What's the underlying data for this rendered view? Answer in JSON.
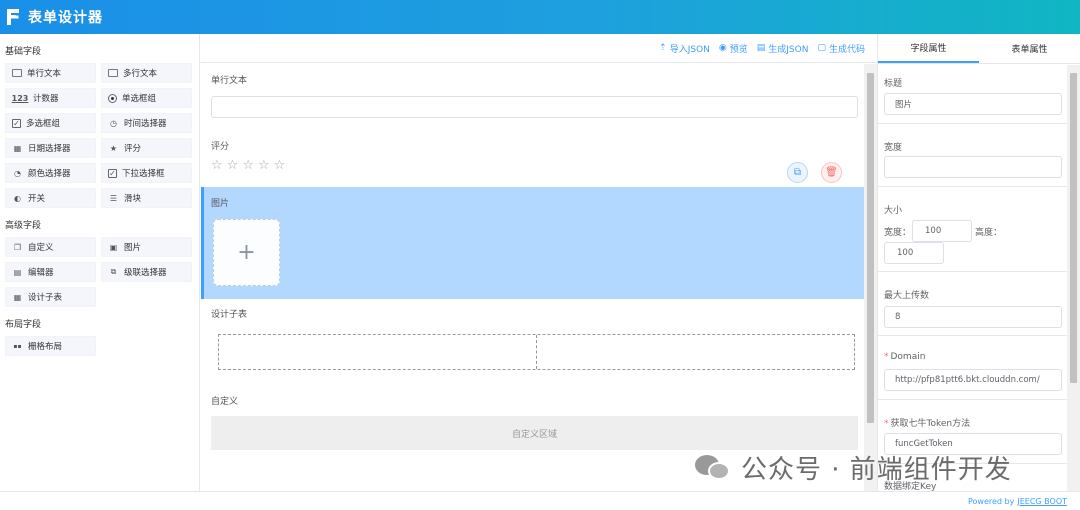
{
  "header": {
    "title": "表单设计器"
  },
  "left": {
    "groups": [
      {
        "title": "基础字段",
        "items": [
          {
            "label": "单行文本",
            "icon": "input-icon"
          },
          {
            "label": "多行文本",
            "icon": "textarea-icon"
          },
          {
            "label": "计数器",
            "icon": "number-icon",
            "glyph": "123"
          },
          {
            "label": "单选框组",
            "icon": "radio-icon"
          },
          {
            "label": "多选框组",
            "icon": "checkbox-icon",
            "glyph": "✓"
          },
          {
            "label": "时间选择器",
            "icon": "clock-icon",
            "glyph": "◷"
          },
          {
            "label": "日期选择器",
            "icon": "calendar-icon",
            "glyph": "▦"
          },
          {
            "label": "评分",
            "icon": "star-icon",
            "glyph": "★"
          },
          {
            "label": "颜色选择器",
            "icon": "palette-icon",
            "glyph": "◔"
          },
          {
            "label": "下拉选择框",
            "icon": "select-icon",
            "glyph": "✓"
          },
          {
            "label": "开关",
            "icon": "switch-icon",
            "glyph": "◐"
          },
          {
            "label": "滑块",
            "icon": "slider-icon",
            "glyph": "☰"
          }
        ]
      },
      {
        "title": "高级字段",
        "items": [
          {
            "label": "自定义",
            "icon": "custom-icon",
            "glyph": "❐"
          },
          {
            "label": "图片",
            "icon": "image-icon",
            "glyph": "▣"
          },
          {
            "label": "编辑器",
            "icon": "editor-icon",
            "glyph": "▤"
          },
          {
            "label": "级联选择器",
            "icon": "cascader-icon",
            "glyph": "⧉"
          },
          {
            "label": "设计子表",
            "icon": "subtable-icon",
            "glyph": "▦"
          }
        ]
      },
      {
        "title": "布局字段",
        "items": [
          {
            "label": "栅格布局",
            "icon": "grid-icon",
            "glyph": "▪▪"
          }
        ]
      }
    ]
  },
  "toolbar": {
    "import_json": "导入JSON",
    "preview": "预览",
    "generate_json": "生成JSON",
    "generate_code": "生成代码"
  },
  "canvas": {
    "single_text_label": "单行文本",
    "rate_label": "评分",
    "stars": [
      "☆",
      "☆",
      "☆",
      "☆",
      "☆"
    ],
    "image_label": "图片",
    "upload_plus": "+",
    "subtable_label": "设计子表",
    "custom_label": "自定义",
    "custom_area_text": "自定义区域"
  },
  "right": {
    "tab_field": "字段属性",
    "tab_form": "表单属性",
    "title_label": "标题",
    "title_value": "图片",
    "width_label": "宽度",
    "width_value": "",
    "size_label": "大小",
    "size_width_label": "宽度：",
    "size_width_value": "100",
    "size_height_label": "高度：",
    "size_height_value": "100",
    "max_upload_label": "最大上传数",
    "max_upload_value": "8",
    "required_mark": "*",
    "domain_label": "Domain",
    "domain_value": "http://pfp81ptt6.bkt.clouddn.com/",
    "token_label": "获取七牛Token方法",
    "token_value": "funcGetToken",
    "bind_key_label": "数据绑定Key"
  },
  "footer": {
    "powered_by": "Powered by",
    "brand": "JEECG BOOT"
  },
  "watermark": {
    "text": "公众号 · 前端组件开发"
  }
}
